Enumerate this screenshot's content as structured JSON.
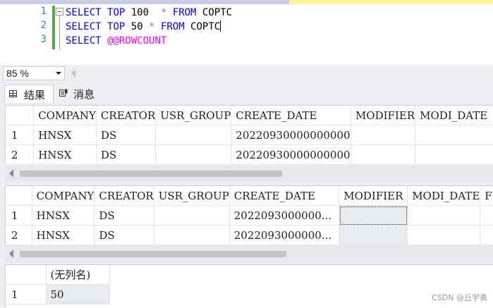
{
  "editor": {
    "lines": [
      {
        "num": "1",
        "tokens": [
          {
            "t": "SELECT",
            "c": "kw"
          },
          {
            "t": " ",
            "c": "id"
          },
          {
            "t": "TOP",
            "c": "kw"
          },
          {
            "t": " 100  ",
            "c": "id"
          },
          {
            "t": "*",
            "c": "op"
          },
          {
            "t": " ",
            "c": "id"
          },
          {
            "t": "FROM",
            "c": "kw"
          },
          {
            "t": " COPTC",
            "c": "id"
          }
        ]
      },
      {
        "num": "2",
        "tokens": [
          {
            "t": "SELECT",
            "c": "kw"
          },
          {
            "t": " ",
            "c": "id"
          },
          {
            "t": "TOP",
            "c": "kw"
          },
          {
            "t": " 50 ",
            "c": "id"
          },
          {
            "t": "*",
            "c": "op"
          },
          {
            "t": " ",
            "c": "id"
          },
          {
            "t": "FROM",
            "c": "kw"
          },
          {
            "t": " COPTC",
            "c": "id"
          }
        ]
      },
      {
        "num": "3",
        "tokens": [
          {
            "t": "SELECT",
            "c": "kw"
          },
          {
            "t": " ",
            "c": "id"
          },
          {
            "t": "@@ROWCOUNT",
            "c": "fn"
          }
        ]
      }
    ]
  },
  "zoom": {
    "value": "85 %"
  },
  "tabs": [
    {
      "label": "结果",
      "icon": "grid-icon",
      "active": true
    },
    {
      "label": "消息",
      "icon": "message-icon",
      "active": false
    }
  ],
  "grid1": {
    "columns": [
      "",
      "COMPANY",
      "CREATOR",
      "USR_GROUP",
      "CREATE_DATE",
      "MODIFIER",
      "MODI_DATE"
    ],
    "rows": [
      [
        "1",
        "HNSX",
        "DS",
        "",
        "20220930000000000",
        "",
        ""
      ],
      [
        "2",
        "HNSX",
        "DS",
        "",
        "20220930000000000",
        "",
        ""
      ]
    ]
  },
  "grid2": {
    "columns": [
      "",
      "COMPANY",
      "CREATOR",
      "USR_GROUP",
      "CREATE_DATE",
      "MODIFIER",
      "MODI_DATE",
      "F"
    ],
    "rows": [
      [
        "1",
        "HNSX",
        "DS",
        "",
        "2022093000000...",
        "",
        "",
        ""
      ],
      [
        "2",
        "HNSX",
        "DS",
        "",
        "2022093000000...",
        "",
        "",
        ""
      ]
    ]
  },
  "grid3": {
    "columns": [
      "",
      "(无列名)"
    ],
    "rows": [
      [
        "1",
        "50"
      ]
    ]
  },
  "watermark": "CSDN @丘宇勇"
}
